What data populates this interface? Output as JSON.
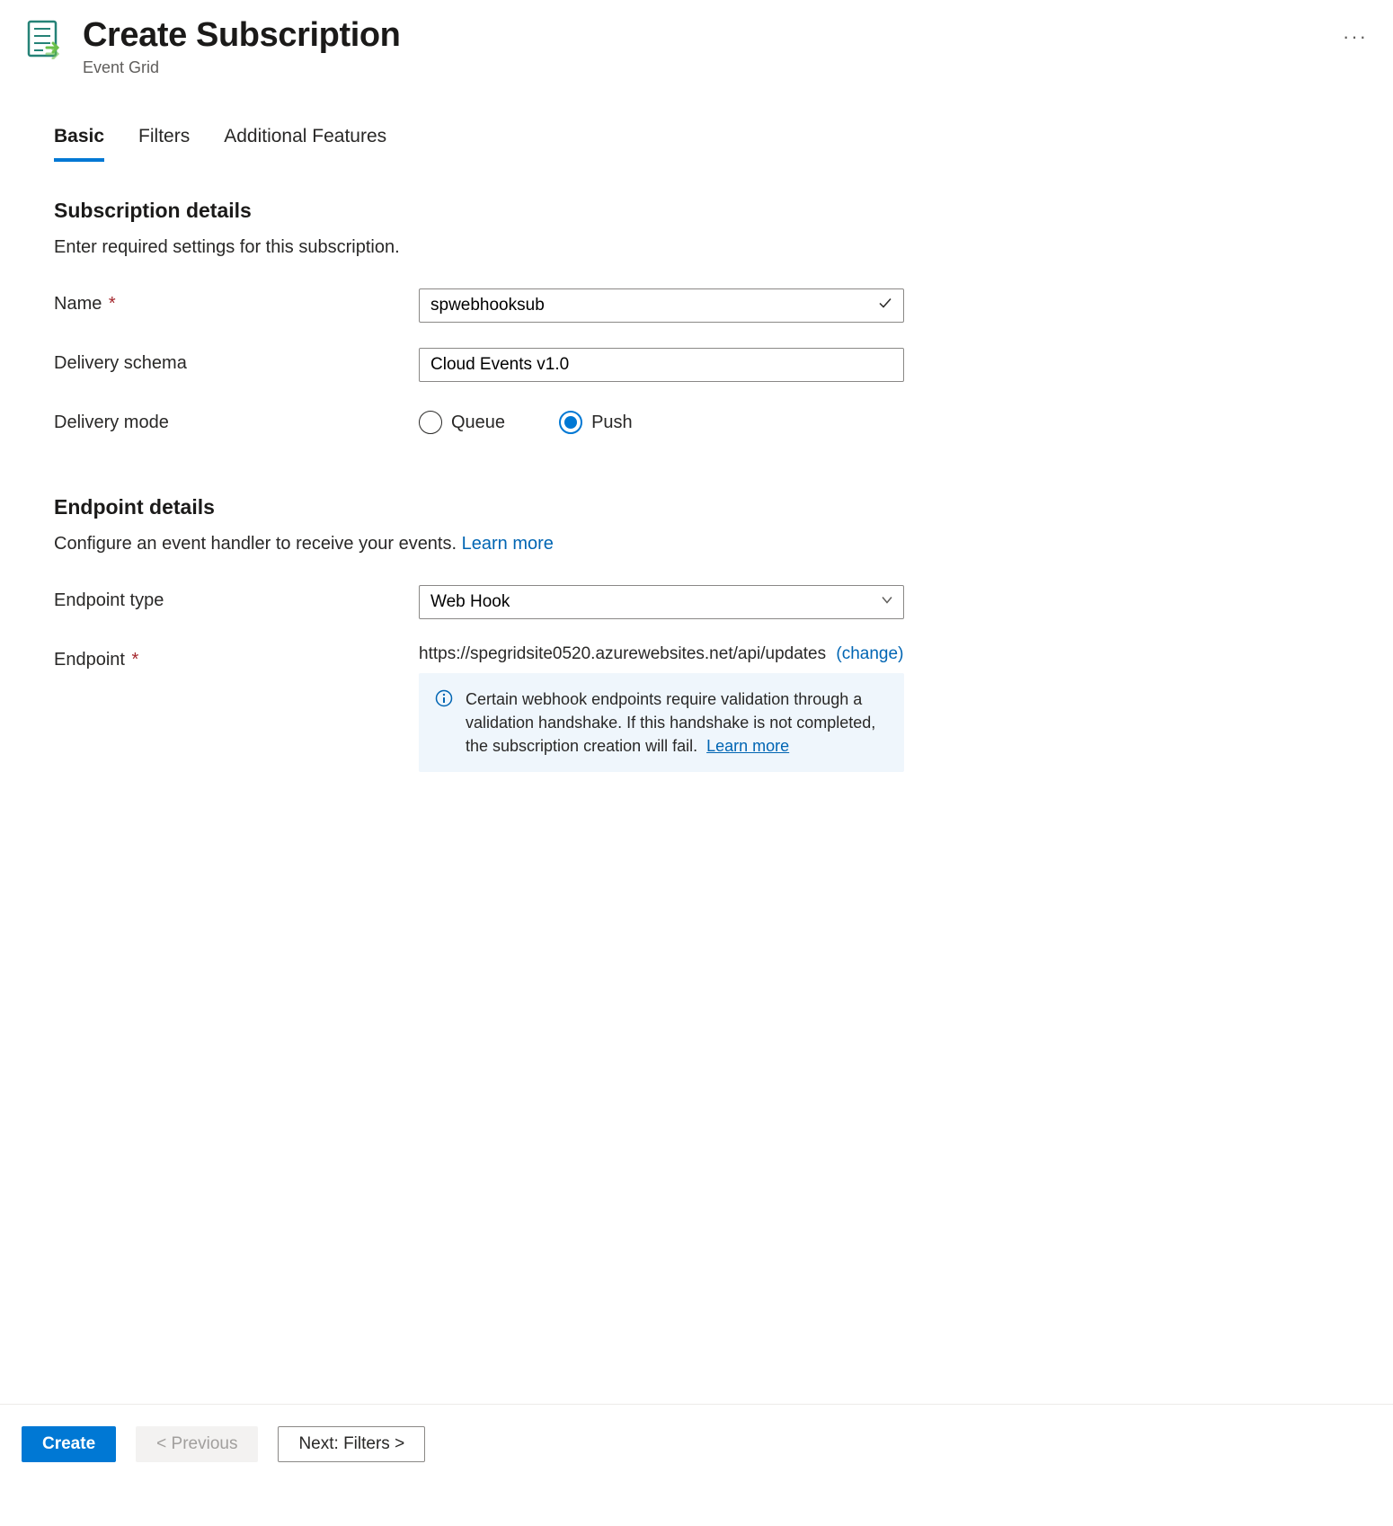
{
  "header": {
    "title": "Create Subscription",
    "subtitle": "Event Grid",
    "more_label": "···"
  },
  "tabs": [
    {
      "label": "Basic",
      "active": true
    },
    {
      "label": "Filters",
      "active": false
    },
    {
      "label": "Additional Features",
      "active": false
    }
  ],
  "subscription": {
    "section_title": "Subscription details",
    "section_desc": "Enter required settings for this subscription.",
    "name_label": "Name",
    "name_value": "spwebhooksub",
    "schema_label": "Delivery schema",
    "schema_value": "Cloud Events v1.0",
    "mode_label": "Delivery mode",
    "mode_options": {
      "queue": "Queue",
      "push": "Push"
    },
    "mode_selected": "push"
  },
  "endpoint": {
    "section_title": "Endpoint details",
    "section_desc": "Configure an event handler to receive your events.",
    "learn_more": "Learn more",
    "type_label": "Endpoint type",
    "type_value": "Web Hook",
    "endpoint_label": "Endpoint",
    "endpoint_url": "https://spegridsite0520.azurewebsites.net/api/updates",
    "change_label": "(change)",
    "info_text": "Certain webhook endpoints require validation through a validation handshake. If this handshake is not completed, the subscription creation will fail.",
    "info_learn_more": "Learn more"
  },
  "footer": {
    "create": "Create",
    "previous": "< Previous",
    "next": "Next: Filters >"
  }
}
